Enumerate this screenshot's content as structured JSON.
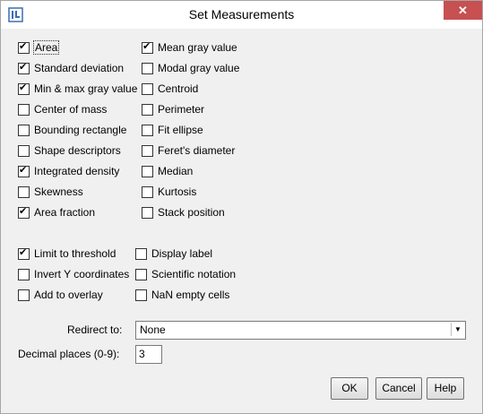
{
  "window": {
    "title": "Set Measurements",
    "close_glyph": "✕"
  },
  "col1": [
    {
      "label": "Area",
      "checked": true
    },
    {
      "label": "Standard deviation",
      "checked": true
    },
    {
      "label": "Min & max gray value",
      "checked": true
    },
    {
      "label": "Center of mass",
      "checked": false
    },
    {
      "label": "Bounding rectangle",
      "checked": false
    },
    {
      "label": "Shape descriptors",
      "checked": false
    },
    {
      "label": "Integrated density",
      "checked": true
    },
    {
      "label": "Skewness",
      "checked": false
    },
    {
      "label": "Area fraction",
      "checked": true
    }
  ],
  "col2": [
    {
      "label": "Mean gray value",
      "checked": true
    },
    {
      "label": "Modal gray value",
      "checked": false
    },
    {
      "label": "Centroid",
      "checked": false
    },
    {
      "label": "Perimeter",
      "checked": false
    },
    {
      "label": "Fit ellipse",
      "checked": false
    },
    {
      "label": "Feret's diameter",
      "checked": false
    },
    {
      "label": "Median",
      "checked": false
    },
    {
      "label": "Kurtosis",
      "checked": false
    },
    {
      "label": "Stack position",
      "checked": false
    }
  ],
  "options1": [
    {
      "label": "Limit to threshold",
      "checked": true
    },
    {
      "label": "Invert Y coordinates",
      "checked": false
    },
    {
      "label": "Add to overlay",
      "checked": false
    }
  ],
  "options2": [
    {
      "label": "Display label",
      "checked": false
    },
    {
      "label": "Scientific notation",
      "checked": false
    },
    {
      "label": "NaN empty cells",
      "checked": false
    }
  ],
  "redirect": {
    "label": "Redirect to:",
    "value": "None"
  },
  "decimal": {
    "label": "Decimal places (0-9):",
    "value": "3"
  },
  "buttons": {
    "ok": "OK",
    "cancel": "Cancel",
    "help": "Help"
  }
}
